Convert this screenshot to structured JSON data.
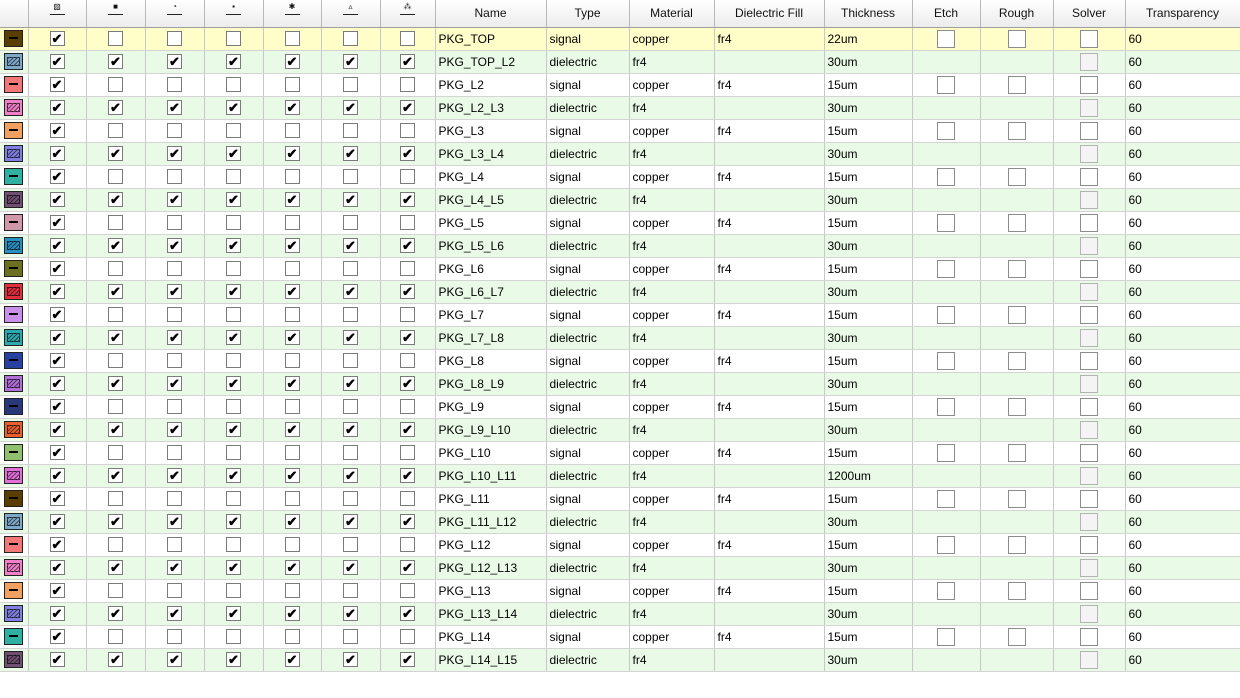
{
  "columns": {
    "icon_cols": [
      {
        "icon": "swatch-icon"
      },
      {
        "icon": "visibility-icon"
      },
      {
        "icon": "drill-icon"
      },
      {
        "icon": "layer-icon"
      },
      {
        "icon": "net-icon"
      },
      {
        "icon": "bump-icon"
      },
      {
        "icon": "via-icon"
      }
    ],
    "name": "Name",
    "type": "Type",
    "material": "Material",
    "dielectric_fill": "Dielectric Fill",
    "thickness": "Thickness",
    "etch": "Etch",
    "rough": "Rough",
    "solver": "Solver",
    "transparency": "Transparency"
  },
  "rows": [
    {
      "color": "#5a3e00",
      "name": "PKG_TOP",
      "type": "signal",
      "material": "copper",
      "fill": "fr4",
      "thickness": "22um",
      "transparency": "60",
      "checks": [
        true,
        false,
        false,
        false,
        false,
        false,
        false
      ],
      "selected": true
    },
    {
      "color": "#7ea8c8",
      "name": "PKG_TOP_L2",
      "type": "dielectric",
      "material": "fr4",
      "fill": "",
      "thickness": "30um",
      "transparency": "60",
      "checks": [
        true,
        true,
        true,
        true,
        true,
        true,
        true
      ]
    },
    {
      "color": "#f07878",
      "name": "PKG_L2",
      "type": "signal",
      "material": "copper",
      "fill": "fr4",
      "thickness": "15um",
      "transparency": "60",
      "checks": [
        true,
        false,
        false,
        false,
        false,
        false,
        false
      ]
    },
    {
      "color": "#f080c8",
      "name": "PKG_L2_L3",
      "type": "dielectric",
      "material": "fr4",
      "fill": "",
      "thickness": "30um",
      "transparency": "60",
      "checks": [
        true,
        true,
        true,
        true,
        true,
        true,
        true
      ]
    },
    {
      "color": "#f0a060",
      "name": "PKG_L3",
      "type": "signal",
      "material": "copper",
      "fill": "fr4",
      "thickness": "15um",
      "transparency": "60",
      "checks": [
        true,
        false,
        false,
        false,
        false,
        false,
        false
      ]
    },
    {
      "color": "#8080e0",
      "name": "PKG_L3_L4",
      "type": "dielectric",
      "material": "fr4",
      "fill": "",
      "thickness": "30um",
      "transparency": "60",
      "checks": [
        true,
        true,
        true,
        true,
        true,
        true,
        true
      ]
    },
    {
      "color": "#30b0a0",
      "name": "PKG_L4",
      "type": "signal",
      "material": "copper",
      "fill": "fr4",
      "thickness": "15um",
      "transparency": "60",
      "checks": [
        true,
        false,
        false,
        false,
        false,
        false,
        false
      ]
    },
    {
      "color": "#705070",
      "name": "PKG_L4_L5",
      "type": "dielectric",
      "material": "fr4",
      "fill": "",
      "thickness": "30um",
      "transparency": "60",
      "checks": [
        true,
        true,
        true,
        true,
        true,
        true,
        true
      ]
    },
    {
      "color": "#d098a8",
      "name": "PKG_L5",
      "type": "signal",
      "material": "copper",
      "fill": "fr4",
      "thickness": "15um",
      "transparency": "60",
      "checks": [
        true,
        false,
        false,
        false,
        false,
        false,
        false
      ]
    },
    {
      "color": "#2890c0",
      "name": "PKG_L5_L6",
      "type": "dielectric",
      "material": "fr4",
      "fill": "",
      "thickness": "30um",
      "transparency": "60",
      "checks": [
        true,
        true,
        true,
        true,
        true,
        true,
        true
      ]
    },
    {
      "color": "#6a7020",
      "name": "PKG_L6",
      "type": "signal",
      "material": "copper",
      "fill": "fr4",
      "thickness": "15um",
      "transparency": "60",
      "checks": [
        true,
        false,
        false,
        false,
        false,
        false,
        false
      ]
    },
    {
      "color": "#e03040",
      "name": "PKG_L6_L7",
      "type": "dielectric",
      "material": "fr4",
      "fill": "",
      "thickness": "30um",
      "transparency": "60",
      "checks": [
        true,
        true,
        true,
        true,
        true,
        true,
        true
      ]
    },
    {
      "color": "#c890e8",
      "name": "PKG_L7",
      "type": "signal",
      "material": "copper",
      "fill": "fr4",
      "thickness": "15um",
      "transparency": "60",
      "checks": [
        true,
        false,
        false,
        false,
        false,
        false,
        false
      ]
    },
    {
      "color": "#30a8b0",
      "name": "PKG_L7_L8",
      "type": "dielectric",
      "material": "fr4",
      "fill": "",
      "thickness": "30um",
      "transparency": "60",
      "checks": [
        true,
        true,
        true,
        true,
        true,
        true,
        true
      ]
    },
    {
      "color": "#2840a0",
      "name": "PKG_L8",
      "type": "signal",
      "material": "copper",
      "fill": "fr4",
      "thickness": "15um",
      "transparency": "60",
      "checks": [
        true,
        false,
        false,
        false,
        false,
        false,
        false
      ]
    },
    {
      "color": "#b070d8",
      "name": "PKG_L8_L9",
      "type": "dielectric",
      "material": "fr4",
      "fill": "",
      "thickness": "30um",
      "transparency": "60",
      "checks": [
        true,
        true,
        true,
        true,
        true,
        true,
        true
      ]
    },
    {
      "color": "#283878",
      "name": "PKG_L9",
      "type": "signal",
      "material": "copper",
      "fill": "fr4",
      "thickness": "15um",
      "transparency": "60",
      "checks": [
        true,
        false,
        false,
        false,
        false,
        false,
        false
      ]
    },
    {
      "color": "#e86030",
      "name": "PKG_L9_L10",
      "type": "dielectric",
      "material": "fr4",
      "fill": "",
      "thickness": "30um",
      "transparency": "60",
      "checks": [
        true,
        true,
        true,
        true,
        true,
        true,
        true
      ]
    },
    {
      "color": "#90c070",
      "name": "PKG_L10",
      "type": "signal",
      "material": "copper",
      "fill": "fr4",
      "thickness": "15um",
      "transparency": "60",
      "checks": [
        true,
        false,
        false,
        false,
        false,
        false,
        false
      ]
    },
    {
      "color": "#e070d8",
      "name": "PKG_L10_L11",
      "type": "dielectric",
      "material": "fr4",
      "fill": "",
      "thickness": "1200um",
      "transparency": "60",
      "checks": [
        true,
        true,
        true,
        true,
        true,
        true,
        true
      ]
    },
    {
      "color": "#5a3e00",
      "name": "PKG_L11",
      "type": "signal",
      "material": "copper",
      "fill": "fr4",
      "thickness": "15um",
      "transparency": "60",
      "checks": [
        true,
        false,
        false,
        false,
        false,
        false,
        false
      ]
    },
    {
      "color": "#7ea8c8",
      "name": "PKG_L11_L12",
      "type": "dielectric",
      "material": "fr4",
      "fill": "",
      "thickness": "30um",
      "transparency": "60",
      "checks": [
        true,
        true,
        true,
        true,
        true,
        true,
        true
      ]
    },
    {
      "color": "#f07878",
      "name": "PKG_L12",
      "type": "signal",
      "material": "copper",
      "fill": "fr4",
      "thickness": "15um",
      "transparency": "60",
      "checks": [
        true,
        false,
        false,
        false,
        false,
        false,
        false
      ]
    },
    {
      "color": "#f080c8",
      "name": "PKG_L12_L13",
      "type": "dielectric",
      "material": "fr4",
      "fill": "",
      "thickness": "30um",
      "transparency": "60",
      "checks": [
        true,
        true,
        true,
        true,
        true,
        true,
        true
      ]
    },
    {
      "color": "#f0a060",
      "name": "PKG_L13",
      "type": "signal",
      "material": "copper",
      "fill": "fr4",
      "thickness": "15um",
      "transparency": "60",
      "checks": [
        true,
        false,
        false,
        false,
        false,
        false,
        false
      ]
    },
    {
      "color": "#8080e0",
      "name": "PKG_L13_L14",
      "type": "dielectric",
      "material": "fr4",
      "fill": "",
      "thickness": "30um",
      "transparency": "60",
      "checks": [
        true,
        true,
        true,
        true,
        true,
        true,
        true
      ]
    },
    {
      "color": "#30b0a0",
      "name": "PKG_L14",
      "type": "signal",
      "material": "copper",
      "fill": "fr4",
      "thickness": "15um",
      "transparency": "60",
      "checks": [
        true,
        false,
        false,
        false,
        false,
        false,
        false
      ]
    },
    {
      "color": "#705070",
      "name": "PKG_L14_L15",
      "type": "dielectric",
      "material": "fr4",
      "fill": "",
      "thickness": "30um",
      "transparency": "60",
      "checks": [
        true,
        true,
        true,
        true,
        true,
        true,
        true
      ]
    }
  ]
}
